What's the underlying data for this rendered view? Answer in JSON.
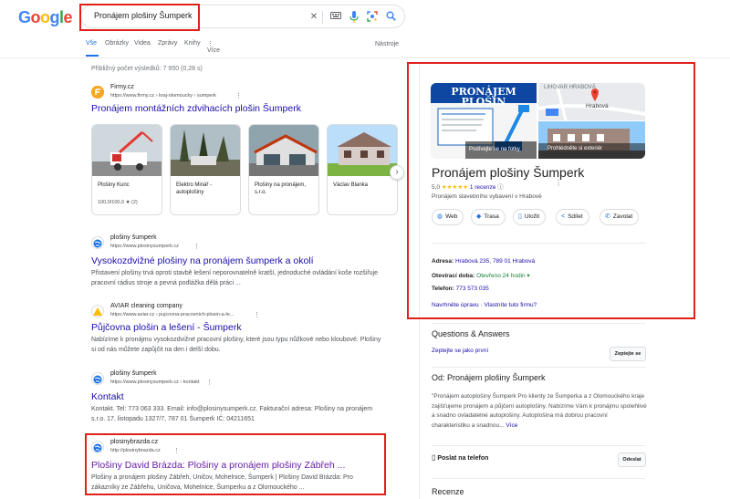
{
  "header": {
    "logo": [
      "G",
      "o",
      "o",
      "g",
      "l",
      "e"
    ],
    "logo_colors": [
      "#4285f4",
      "#ea4335",
      "#fbbc05",
      "#4285f4",
      "#34a853",
      "#ea4335"
    ],
    "query": "Pronájem plošiny Šumperk"
  },
  "tabs": [
    "Vše",
    "Obrázky",
    "Videa",
    "Zprávy",
    "Knihy",
    "⋮ Více"
  ],
  "tools_label": "Nástroje",
  "stats": "Přibližný počet výsledků: 7 950 (0,28 s)",
  "results": [
    {
      "site": "Firmy.cz",
      "url": "https://www.firmy.cz › kraj-olomoucky › sumperk",
      "title": "Pronájem montážních zdvihacích plošin Šumperk",
      "cards": [
        {
          "name": "Plošiny Kunc",
          "rating": "100,0/100,0 ★ (2)"
        },
        {
          "name": "Elektro Minář - autoplošiny",
          "rating": ""
        },
        {
          "name": "Plošiny na pronájem, s.r.o.",
          "rating": ""
        },
        {
          "name": "Václav Blanka",
          "rating": ""
        }
      ]
    },
    {
      "site": "plošiny šumperk",
      "url": "https://www.plosinysumperk.cz",
      "title": "Vysokozdvižné plošiny na pronájem šumperk a okolí",
      "snippet": "Přistavení plošiny trvá oproti stavbě lešení neporovnatelně kratší, jednoduché ovládání koše rozšiřuje pracovní rádius stroje a pevná podlážka dělá práci ..."
    },
    {
      "site": "AVIAR cleaning company",
      "url": "https://www.aviar.cz › pujcovna-pracovnich-plosin-a-le...",
      "title": "Půjčovna plošin a lešení - Šumperk",
      "snippet": "Nabízíme k pronájmu vysokozdvižné pracovní plošiny, které jsou typu nůžkové nebo kloubové. Plošiny si od nás můžete zapůjčit na den i delší dobu."
    },
    {
      "site": "plošiny šumperk",
      "url": "https://www.plosinysumperk.cz › kontakt",
      "title": "Kontakt",
      "snippet": "Kontakt. Tel: 773 063 333. Email: info@plosinysumperk.cz. Fakturační adresa: Plošiny na pronájem s.r.o. 17. listopadu 1327/7, 787 01 Šumperk IČ: 04211651"
    },
    {
      "site": "plosinybrazda.cz",
      "url": "http://plosinybrazda.cz",
      "title": "Plošiny David Brázda: Plošiny a pronájem plošiny Zábřeh ...",
      "snippet": "Plošiny a pronájem plošiny Zábřeh, Uničov, Mohelnice, Šumperk | Plošiny David Brázda: Pro zákazníky ze Zábřehu, Uničova, Mohelnice, Šumperku a z Olomouckého ..."
    }
  ],
  "knowledge_panel": {
    "photo_banner": "PRONÁJEM PLOŠIN",
    "photo_caption_left": "Podívejte se na fotky",
    "photo_caption_right": "Prohlédněte si exteriér",
    "map_label_top": "LIHOVAR HRABOVÁ",
    "map_label_place": "Hrabová",
    "title": "Pronájem plošiny Šumperk",
    "rating_value": "5,0",
    "stars": "★★★★★",
    "reviews": "1 recenze",
    "category": "Pronájem stavebního vybavení v Hrabové",
    "actions": [
      {
        "icon": "◍",
        "label": "Web"
      },
      {
        "icon": "◆",
        "label": "Trasa"
      },
      {
        "icon": "▯",
        "label": "Uložit"
      },
      {
        "icon": "<",
        "label": "Sdílet"
      },
      {
        "icon": "✆",
        "label": "Zavolat"
      }
    ],
    "address_label": "Adresa:",
    "address": "Hrabová 235, 789 01 Hrabová",
    "hours_label": "Otevírací doba:",
    "hours": "Otevřeno 24 hodin ▾",
    "phone_label": "Telefon:",
    "phone": "773 573 035",
    "suggest": "Navrhněte úpravu · Vlastníte tuto firmu?",
    "qa_title": "Questions & Answers",
    "qa_link": "Zeptejte se jako první",
    "qa_button": "Zeptejte se",
    "from_title": "Od: Pronájem plošiny Šumperk",
    "from_desc": "\"Pronájem autoplošiny Šumperk Pro klienty ze Šumperka a z Olomouckého kraje zajišťujeme pronájem a půjčení autoplošiny. Nabízíme Vám k pronájmu spolehlivé a snadno ovladatelné autoplošiny. Autoplošina má dobrou pracovní charakteristiku a snadnou...",
    "from_more": "Více",
    "send_label": "Poslat na telefon",
    "send_button": "Odeslat",
    "reviews_title": "Recenze"
  }
}
